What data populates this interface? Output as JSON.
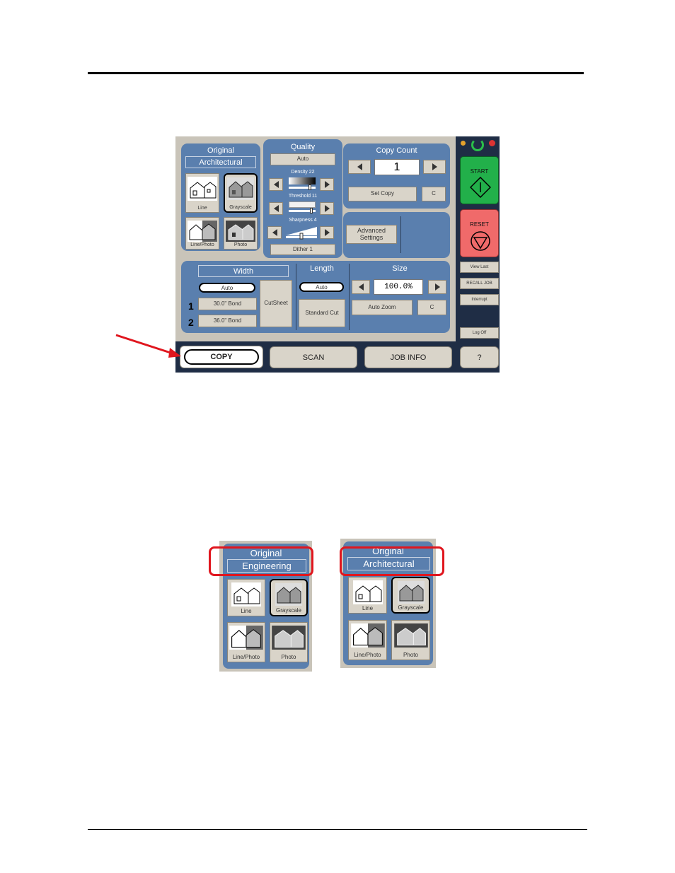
{
  "main": {
    "original": {
      "title": "Original",
      "mode": "Architectural",
      "tiles": [
        "Line",
        "Grayscale",
        "Line/Photo",
        "Photo"
      ]
    },
    "quality": {
      "title": "Quality",
      "mode": "Auto",
      "density_label": "Density  22",
      "threshold_label": "Threshold  11",
      "sharpness_label": "Sharpness  4",
      "dither": "Dither 1"
    },
    "copy_count": {
      "title": "Copy Count",
      "value": "1",
      "set_copy": "Set Copy",
      "clear": "C"
    },
    "advanced": {
      "label": "Advanced Settings"
    },
    "width": {
      "title": "Width",
      "mode": "Auto",
      "roll1": "30.0\" Bond",
      "roll2": "36.0\" Bond",
      "roll1_num": "1",
      "roll2_num": "2",
      "cutsheet": "CutSheet"
    },
    "length": {
      "title": "Length",
      "mode": "Auto",
      "cut": "Standard Cut"
    },
    "size": {
      "title": "Size",
      "value": "100.0%",
      "auto_zoom": "Auto Zoom",
      "clear": "C"
    },
    "side": {
      "start": "START",
      "reset": "RESET",
      "view_last": "View Last",
      "recall": "RECALL JOB",
      "interrupt": "Interrupt",
      "logoff": "Log Off"
    },
    "tabs": {
      "copy": "COPY",
      "scan": "SCAN",
      "job_info": "JOB INFO",
      "help": "?"
    }
  },
  "mini_left": {
    "title": "Original",
    "mode": "Engineering",
    "tiles": [
      "Line",
      "Grayscale",
      "Line/Photo",
      "Photo"
    ]
  },
  "mini_right": {
    "title": "Original",
    "mode": "Architectural",
    "tiles": [
      "Line",
      "Grayscale",
      "Line/Photo",
      "Photo"
    ]
  },
  "colors": {
    "panel": "#5a7fae",
    "start": "#22b04a",
    "reset": "#f06a6a",
    "callout": "#e0161e"
  }
}
